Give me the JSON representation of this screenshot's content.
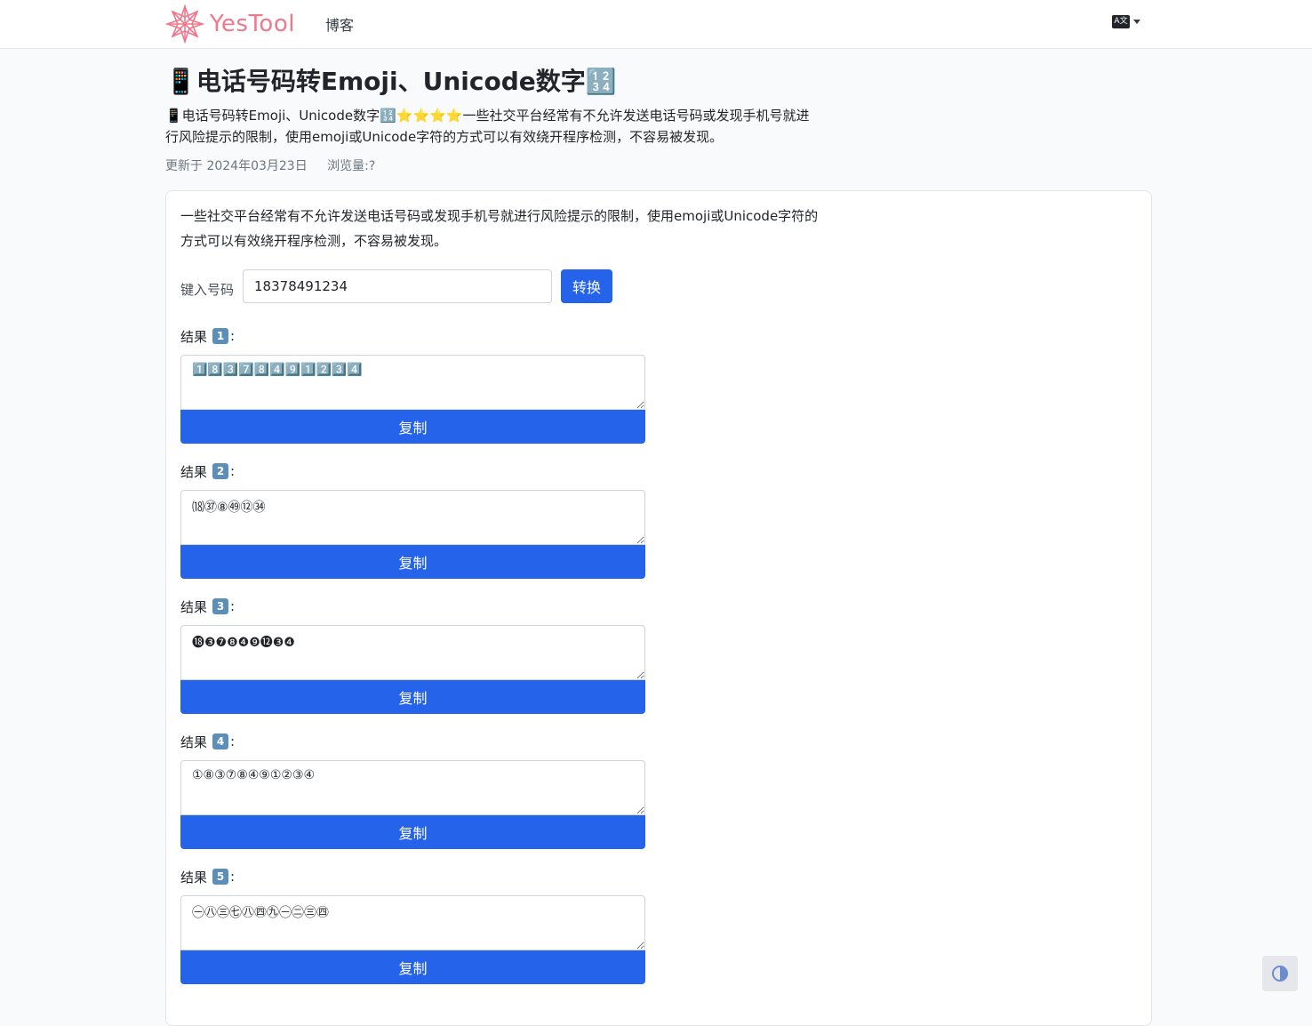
{
  "nav": {
    "logo_text": "YesTool",
    "blog": "博客",
    "lang_icon": "A文"
  },
  "page": {
    "title": "📱电话号码转Emoji、Unicode数字🔢",
    "description": "📱电话号码转Emoji、Unicode数字🔢⭐⭐⭐⭐一些社交平台经常有不允许发送电话号码或发现手机号就进行风险提示的限制，使用emoji或Unicode字符的方式可以有效绕开程序检测，不容易被发现。",
    "updated": "更新于 2024年03月23日",
    "views": "浏览量:?"
  },
  "tool": {
    "intro": "一些社交平台经常有不允许发送电话号码或发现手机号就进行风险提示的限制，使用emoji或Unicode字符的方式可以有效绕开程序检测，不容易被发现。",
    "input_label": "键入号码",
    "input_value": "18378491234",
    "convert_label": "转换",
    "copy_label": "复制",
    "results": [
      {
        "label": "结果",
        "num": "1",
        "value": "1️⃣8️⃣3️⃣7️⃣8️⃣4️⃣9️⃣1️⃣2️⃣3️⃣4️⃣"
      },
      {
        "label": "结果",
        "num": "2",
        "value": "⒅㊲⑧㊾⑫㉞"
      },
      {
        "label": "结果",
        "num": "3",
        "value": "⓲❸❼❽❹❾⓬❸❹"
      },
      {
        "label": "结果",
        "num": "4",
        "value": "①⑧③⑦⑧④⑨①②③④"
      },
      {
        "label": "结果",
        "num": "5",
        "value": "㊀㊇㊂㊆㊇㊃㊈㊀㊁㊂㊃"
      }
    ]
  },
  "icons": {
    "logo": "logo-icon",
    "lang": "translate-icon",
    "theme": "contrast-icon"
  },
  "colors": {
    "primary": "#2563eb",
    "logo": "#f0788c"
  }
}
